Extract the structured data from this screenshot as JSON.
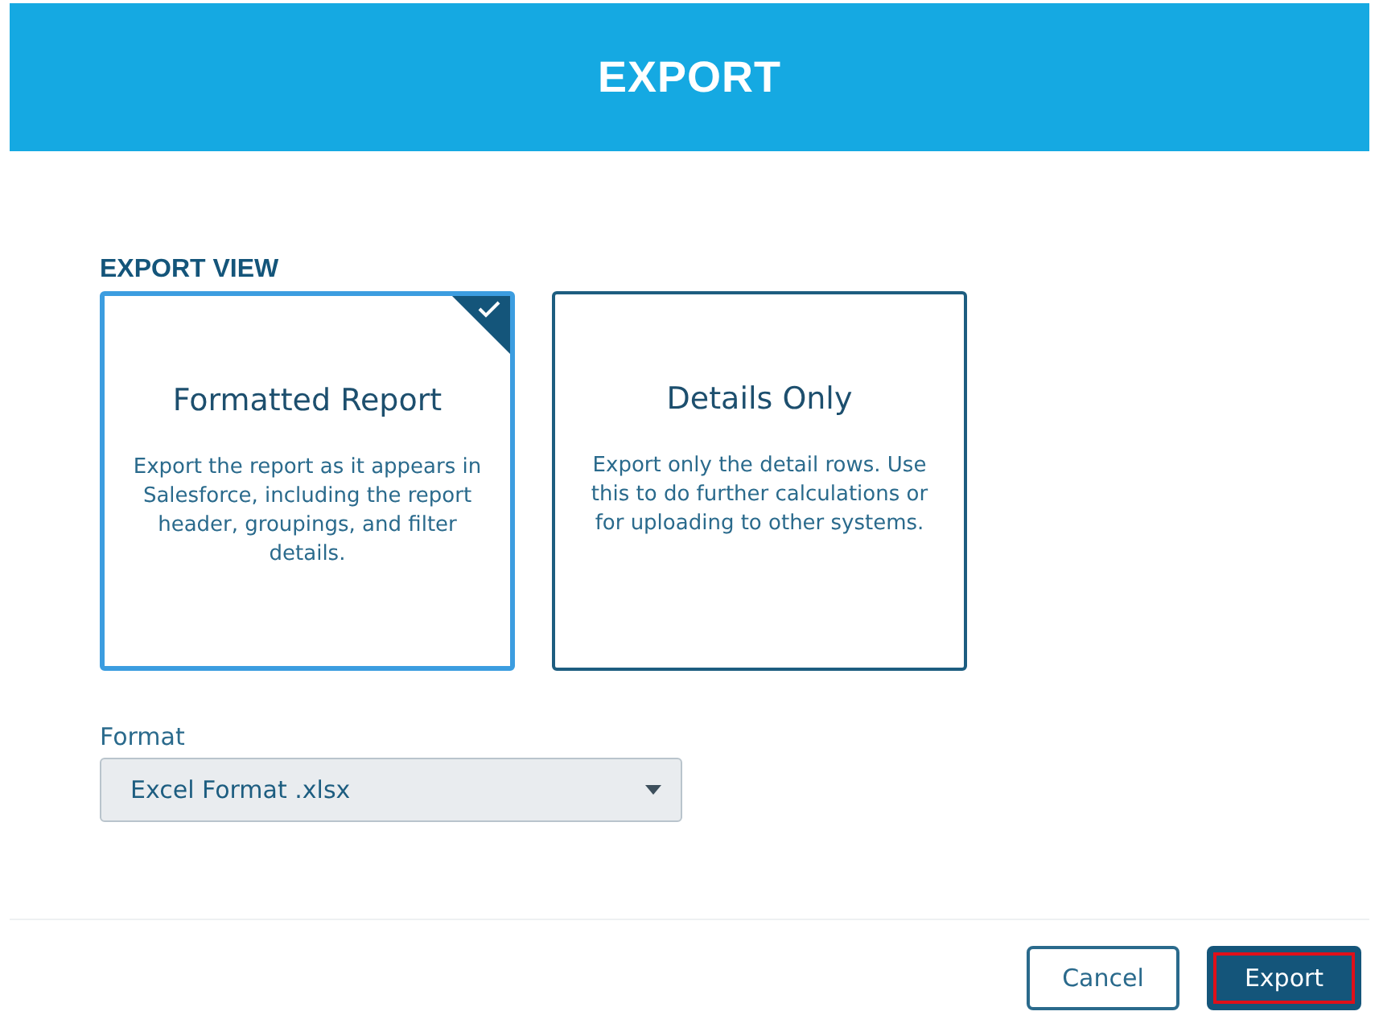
{
  "dialog": {
    "title": "EXPORT"
  },
  "export_view": {
    "label": "EXPORT VIEW",
    "options": [
      {
        "title": "Formatted Report",
        "description": "Export the report as it appears in Salesforce, including the report header, groupings, and filter details.",
        "selected": true
      },
      {
        "title": "Details Only",
        "description": "Export only the detail rows. Use this to do further calculations or for uploading to other systems.",
        "selected": false
      }
    ]
  },
  "format": {
    "label": "Format",
    "value": "Excel Format .xlsx"
  },
  "buttons": [
    {
      "label": "Cancel",
      "kind": "secondary",
      "highlighted": false
    },
    {
      "label": "Export",
      "kind": "primary",
      "highlighted": true
    }
  ]
}
